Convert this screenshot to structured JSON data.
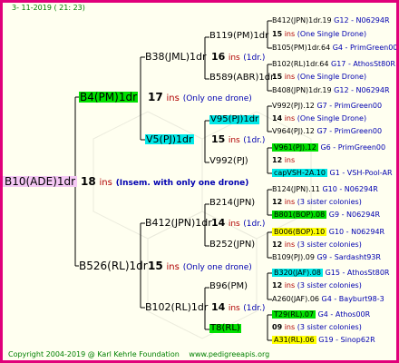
{
  "header": {
    "date": "3- 11-2019 ( 21: 23)"
  },
  "footer": {
    "copyright": "Copyright 2004-2019 @ Karl Kehrle Foundation",
    "website": "www.pedigreeapis.org"
  },
  "root": {
    "name": "B10(ADE)1dr",
    "num": "18",
    "ins": "ins",
    "note": "(Insem. with only one drone)"
  },
  "gen1": [
    {
      "name": "B4(PM)1dr",
      "num": "17",
      "ins": "ins",
      "note": "(Only one drone)"
    },
    {
      "name": "B526(RL)1dr",
      "num": "15",
      "ins": "ins",
      "note": "(Only one drone)"
    }
  ],
  "gen2": [
    {
      "name": "B38(JML)1dr",
      "num": "16",
      "ins": "ins",
      "note": "(1dr.)"
    },
    {
      "name": "V5(PJ)1dr",
      "num": "15",
      "ins": "ins",
      "note": "(1dr.)"
    },
    {
      "name": "B412(JPN)1dr",
      "num": "14",
      "ins": "ins",
      "note": "(1dr.)"
    },
    {
      "name": "B102(RL)1dr",
      "num": "14",
      "ins": "ins",
      "note": "(1dr.)"
    }
  ],
  "gen3": [
    {
      "name": "B119(PM)1dr"
    },
    {
      "name": "B589(ABR)1dr"
    },
    {
      "name": "V95(PJ)1dr"
    },
    {
      "name": "V992(PJ)"
    },
    {
      "name": "B214(JPN)"
    },
    {
      "name": "B252(JPN)"
    },
    {
      "name": "B96(PM)"
    },
    {
      "name": "T8(RL)"
    }
  ],
  "gen4": [
    {
      "top": {
        "name": "B412(JPN)1dr.19",
        "info": "G12 - N06294R"
      },
      "mid": {
        "num": "15",
        "ins": "ins",
        "note": "(One Single Drone)"
      },
      "bot": {
        "name": "B105(PM)1dr.64",
        "info": "G4 - PrimGreen00"
      }
    },
    {
      "top": {
        "name": "B102(RL)1dr.64",
        "info": "G17 - AthosSt80R"
      },
      "mid": {
        "num": "15",
        "ins": "ins",
        "note": "(One Single Drone)"
      },
      "bot": {
        "name": "B408(JPN)1dr.19",
        "info": "G12 - N06294R"
      }
    },
    {
      "top": {
        "name": "V992(PJ).12",
        "info": "G7 - PrimGreen00"
      },
      "mid": {
        "num": "14",
        "ins": "ins",
        "note": "(One Single Drone)"
      },
      "bot": {
        "name": "V964(PJ).12",
        "info": "G7 - PrimGreen00"
      }
    },
    {
      "top": {
        "name": "V961(PJ).12",
        "info": "G6 - PrimGreen00"
      },
      "mid": {
        "num": "12",
        "ins": "ins",
        "note": ""
      },
      "bot": {
        "name": "capVSH-2A.10",
        "info": "G1 - VSH-Pool-AR"
      }
    },
    {
      "top": {
        "name": "B124(JPN).11",
        "info": "G10 - N06294R"
      },
      "mid": {
        "num": "12",
        "ins": "ins",
        "note": "(3 sister colonies)"
      },
      "bot": {
        "name": "B801(BOP).08",
        "info": "G9 - N06294R"
      }
    },
    {
      "top": {
        "name": "B006(BOP).10",
        "info": "G10 - N06294R"
      },
      "mid": {
        "num": "12",
        "ins": "ins",
        "note": "(3 sister colonies)"
      },
      "bot": {
        "name": "B109(PJ).09",
        "info": "G9 - Sardasht93R"
      }
    },
    {
      "top": {
        "name": "B320(JAF).08",
        "info": "G15 - AthosSt80R"
      },
      "mid": {
        "num": "12",
        "ins": "ins",
        "note": "(3 sister colonies)"
      },
      "bot": {
        "name": "A260(JAF).06",
        "info": "G4 - Bayburt98-3"
      }
    },
    {
      "top": {
        "name": "T29(RL).07",
        "info": "G4 - Athos00R"
      },
      "mid": {
        "num": "09",
        "ins": "ins",
        "note": "(3 sister colonies)"
      },
      "bot": {
        "name": "A31(RL).06",
        "info": "G19 - Sinop62R"
      }
    }
  ],
  "colors": {
    "frame": "#e0007a",
    "background": "#fffff0",
    "line": "#000000",
    "highlight_green": "#00e000",
    "highlight_cyan": "#00e8e8",
    "highlight_yellow": "#ffff00",
    "highlight_pink": "#f4c8f4",
    "ins_red": "#b00000",
    "note_blue": "#0000b0",
    "text_green": "#008000"
  },
  "icons": {
    "watermark": "bee-hexagon-watermark"
  }
}
